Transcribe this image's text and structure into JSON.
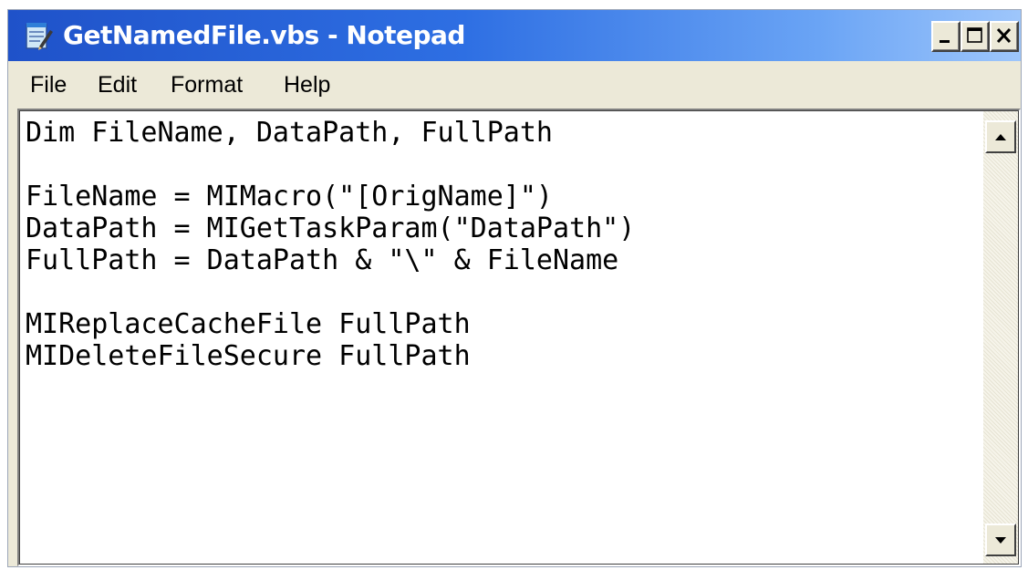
{
  "window": {
    "title": "GetNamedFile.vbs - Notepad",
    "app_icon": "notepad-icon",
    "controls": {
      "minimize_icon": "minimize-icon",
      "maximize_icon": "maximize-icon",
      "close_icon": "close-icon"
    }
  },
  "menubar": {
    "items": [
      {
        "label": "File"
      },
      {
        "label": "Edit"
      },
      {
        "label": "Format"
      },
      {
        "label": "Help"
      }
    ]
  },
  "editor": {
    "content": "Dim FileName, DataPath, FullPath\n\nFileName = MIMacro(\"[OrigName]\")\nDataPath = MIGetTaskParam(\"DataPath\")\nFullPath = DataPath & \"\\\" & FileName\n\nMIReplaceCacheFile FullPath\nMIDeleteFileSecure FullPath"
  },
  "scrollbar": {
    "up_icon": "scroll-up-arrow-icon",
    "down_icon": "scroll-down-arrow-icon"
  },
  "colors": {
    "titlebar_start": "#1f52c9",
    "titlebar_end": "#9ec6fb",
    "chrome": "#ece9d8",
    "editor_bg": "#ffffff"
  }
}
